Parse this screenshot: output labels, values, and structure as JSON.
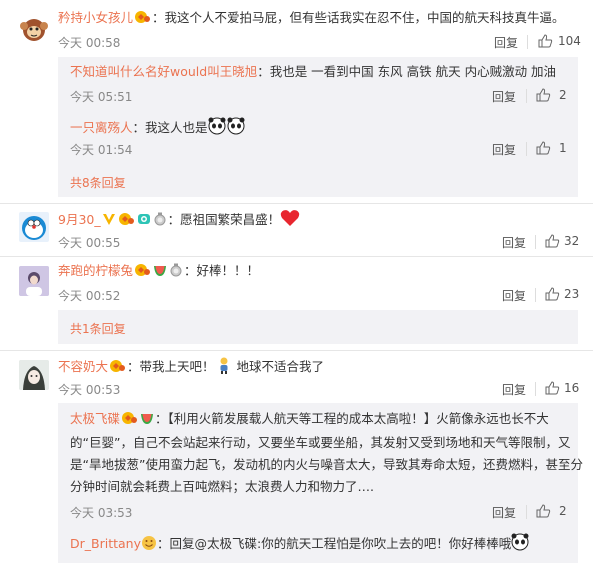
{
  "comments": [
    {
      "user": "矜持小女孩儿",
      "text": "：我这个人不爱拍马屁，但有些话我实在忍不住，中国的航天科技真牛逼。",
      "time": "今天 00:58",
      "reply": "回复",
      "likes": "104",
      "replies": [
        {
          "user": "不知道叫什么名好would叫王晓旭",
          "text": "：我也是 一看到中国 东风 高铁 航天 内心贼激动 加油",
          "time": "今天 05:51",
          "reply": "回复",
          "likes": "2"
        },
        {
          "user": "一只离殇人",
          "text": "：我这人也是",
          "time": "今天 01:54",
          "reply": "回复",
          "likes": "1"
        }
      ],
      "more": "共8条回复"
    },
    {
      "user": "9月30_",
      "text": "：愿祖国繁荣昌盛！",
      "time": "今天 00:55",
      "reply": "回复",
      "likes": "32"
    },
    {
      "user": "奔跑的柠檬兔",
      "text": "：好棒！！！",
      "time": "今天 00:52",
      "reply": "回复",
      "likes": "23",
      "more": "共1条回复"
    },
    {
      "user": "不容奶大",
      "text": "：带我上天吧！",
      "text2": "地球不适合我了",
      "time": "今天 00:53",
      "reply": "回复",
      "likes": "16",
      "replies": [
        {
          "user": "太极飞碟",
          "text_line1": "：【利用火箭发展载人航天等工程的成本太高啦！】火箭像永远也长不大",
          "text_line2": "的“巨婴”，自己不会站起来行动，又要坐车或要坐船，其发射又受到场地和天气等限制，又",
          "text_line3": "是“旱地拔葱”使用蛮力起飞，发动机的内火与噪音太大，导致其寿命太短，还费燃料，甚至分",
          "text_line4": "分钟时间就会耗费上百吨燃料；太浪费人力和物力了….",
          "time": "今天 03:53",
          "reply": "回复",
          "likes": "2"
        },
        {
          "user": "Dr_Brittany",
          "text": "：回复@太极飞碟:你的航天工程怕是你吹上去的吧！你好棒棒哦"
        }
      ]
    }
  ],
  "colors": {
    "username": "#eb7350",
    "subbg": "#f2f2f5",
    "text": "#333333",
    "muted": "#888888"
  }
}
